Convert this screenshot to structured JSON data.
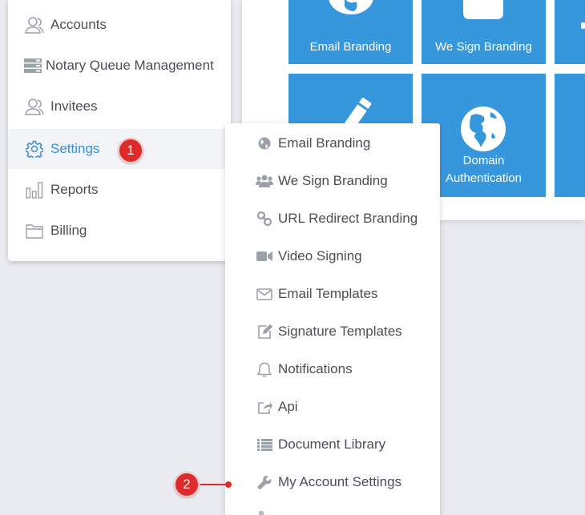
{
  "sidebar": {
    "items": [
      {
        "label": "Accounts",
        "icon": "users-outline-icon"
      },
      {
        "label": "Notary Queue Management",
        "icon": "server-stack-icon"
      },
      {
        "label": "Invitees",
        "icon": "users-outline-icon"
      },
      {
        "label": "Settings",
        "icon": "gear-icon",
        "active": true
      },
      {
        "label": "Reports",
        "icon": "bar-chart-icon"
      },
      {
        "label": "Billing",
        "icon": "folder-icon"
      }
    ]
  },
  "tiles": {
    "email_branding": "Email Branding",
    "we_sign_branding": "We Sign Branding",
    "domain_authentication": "Domain Authentication"
  },
  "submenu": {
    "items": [
      {
        "label": "Email Branding",
        "icon": "globe-icon"
      },
      {
        "label": "We Sign Branding",
        "icon": "users-group-icon"
      },
      {
        "label": "URL Redirect Branding",
        "icon": "link-icon"
      },
      {
        "label": "Video Signing",
        "icon": "video-camera-icon"
      },
      {
        "label": "Email Templates",
        "icon": "envelope-icon"
      },
      {
        "label": "Signature Templates",
        "icon": "edit-icon"
      },
      {
        "label": "Notifications",
        "icon": "bell-icon"
      },
      {
        "label": "Api",
        "icon": "share-icon"
      },
      {
        "label": "Document Library",
        "icon": "list-icon"
      },
      {
        "label": "My Account Settings",
        "icon": "wrench-icon"
      }
    ]
  },
  "callouts": {
    "step_1": "1",
    "step_2": "2"
  },
  "colors": {
    "accent": "#3797dd",
    "active_text": "#3b8ed1",
    "badge": "#dd2b2b",
    "background": "#e9ebf1"
  }
}
